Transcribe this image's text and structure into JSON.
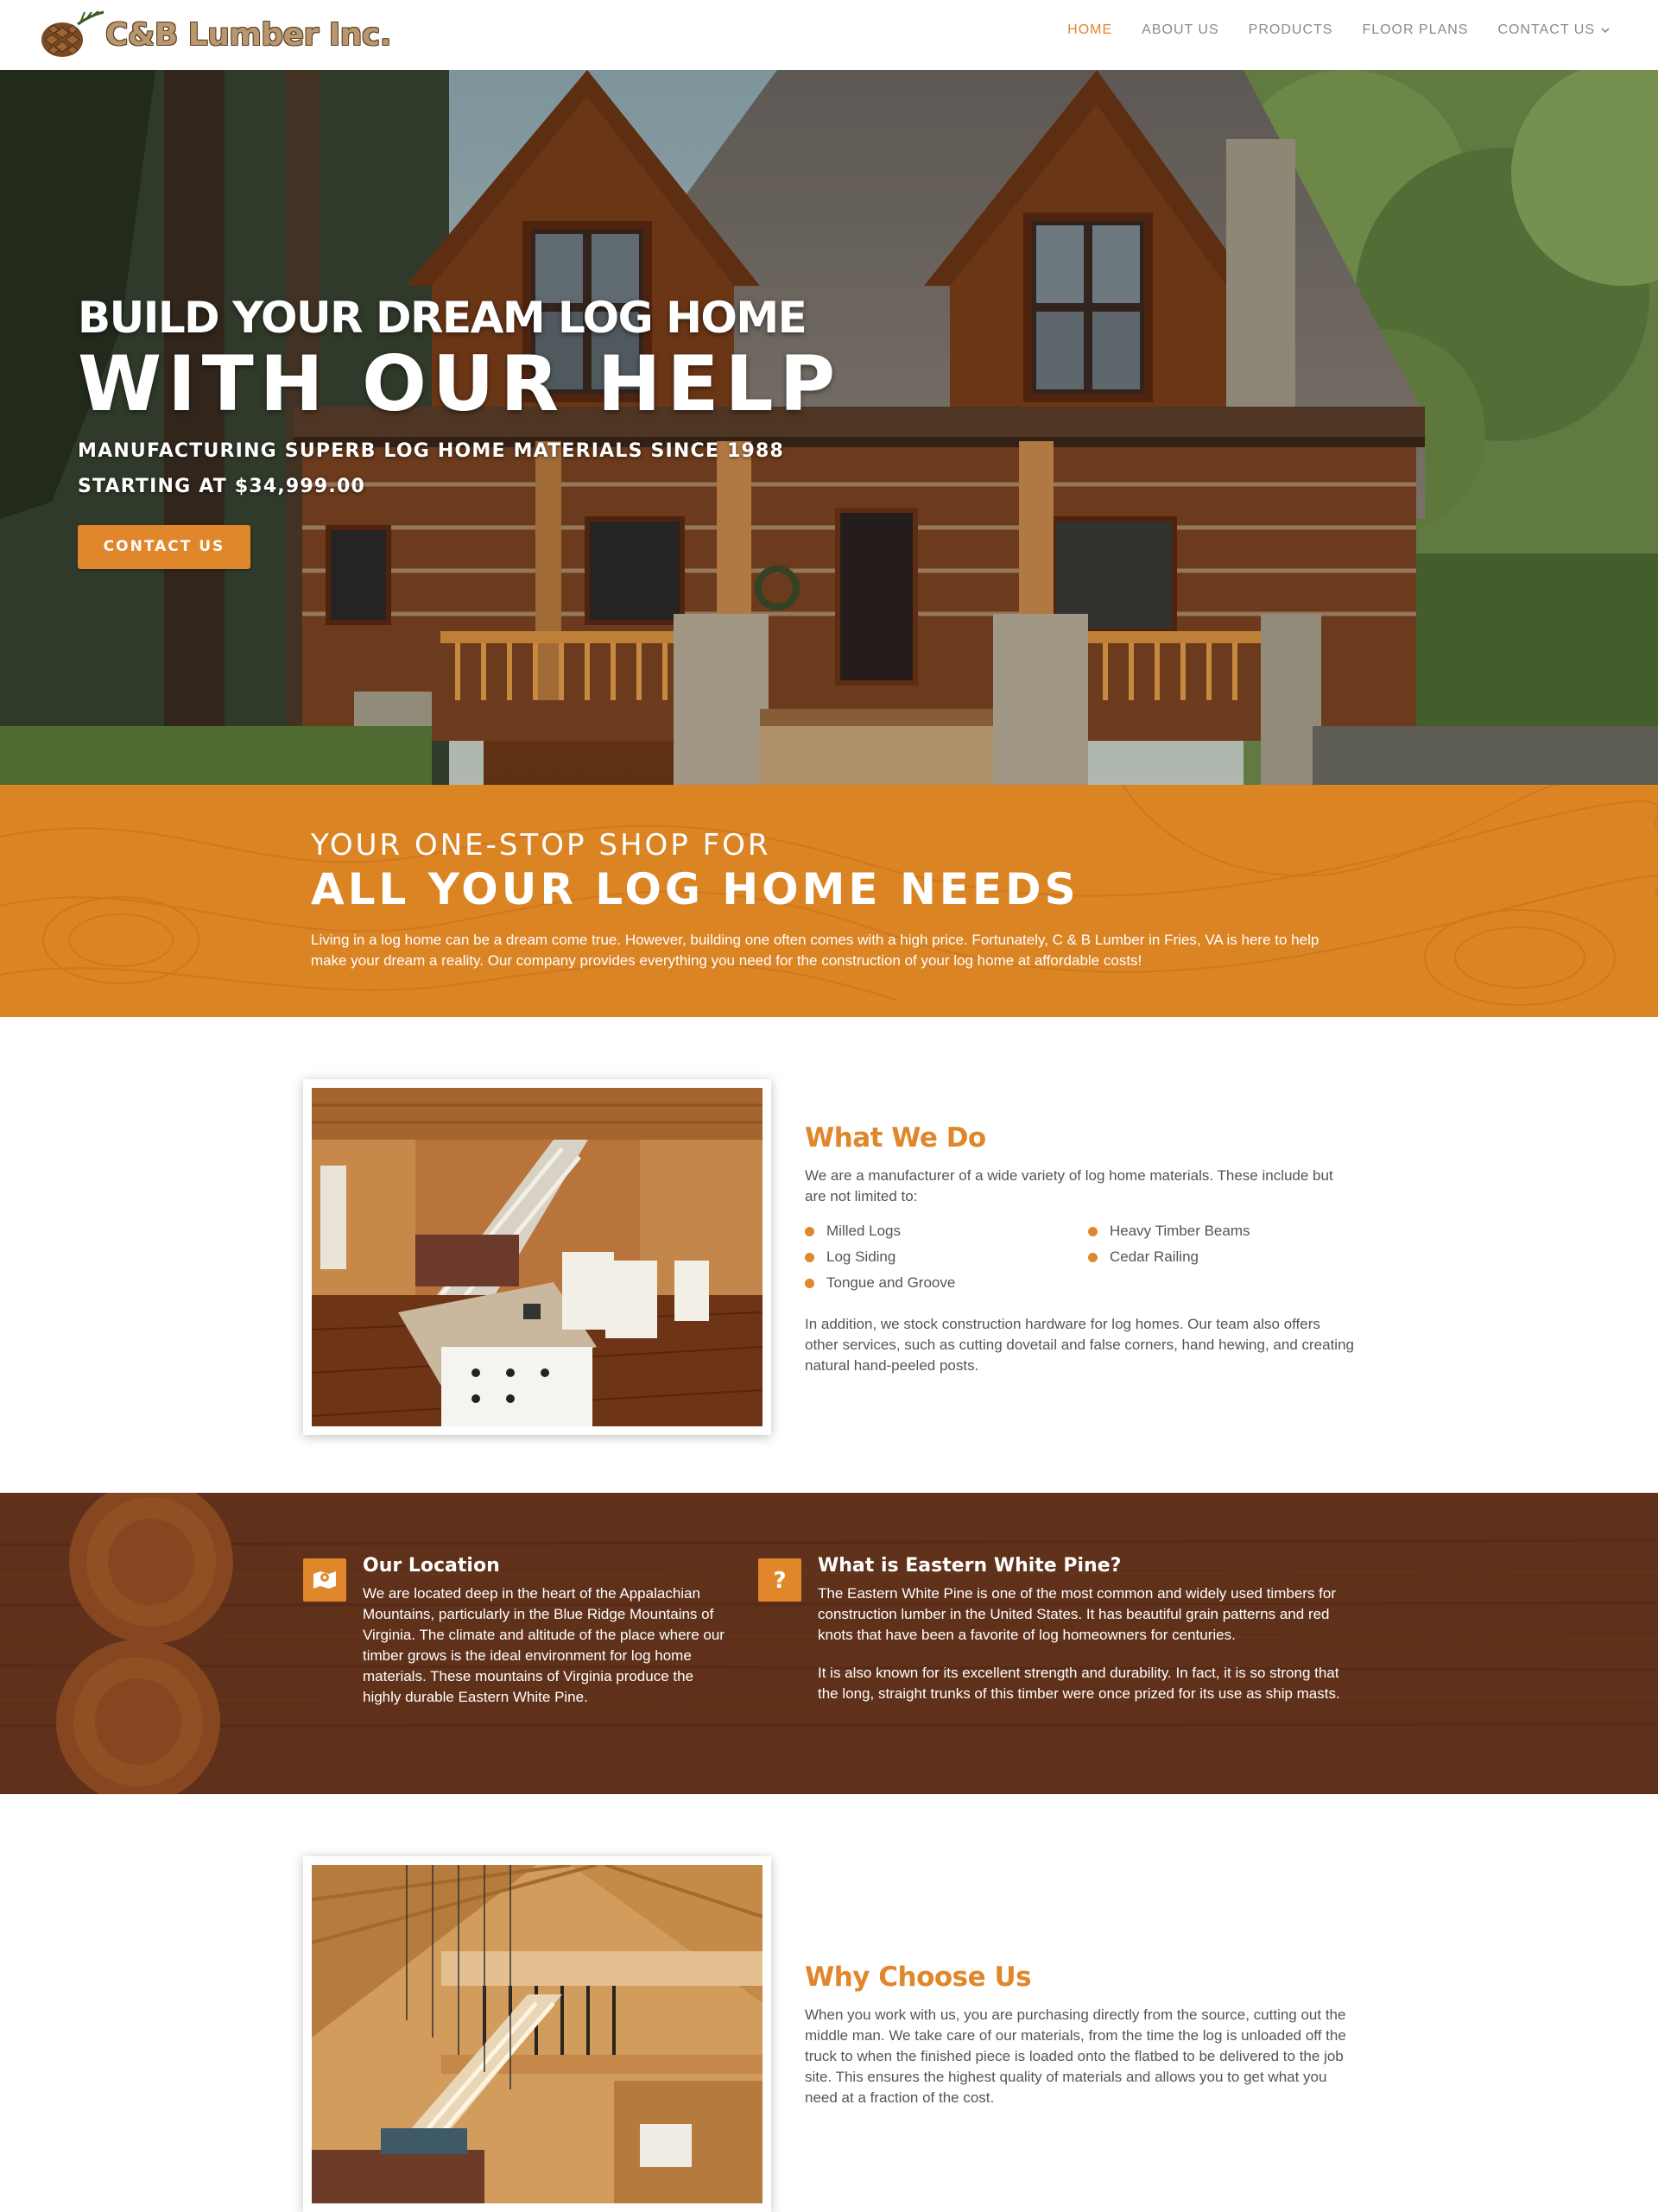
{
  "header": {
    "logo_text": "C&B Lumber Inc.",
    "nav": [
      {
        "label": "HOME",
        "active": true
      },
      {
        "label": "ABOUT US",
        "active": false
      },
      {
        "label": "PRODUCTS",
        "active": false
      },
      {
        "label": "FLOOR PLANS",
        "active": false
      },
      {
        "label": "CONTACT US",
        "active": false
      }
    ]
  },
  "hero": {
    "line1": "BUILD YOUR DREAM LOG HOME",
    "line2": "WITH OUR HELP",
    "subtitle": "MANUFACTURING SUPERB LOG HOME MATERIALS SINCE 1988",
    "price": "STARTING AT $34,999.00",
    "button": "CONTACT US"
  },
  "intro": {
    "line1": "YOUR ONE-STOP SHOP FOR",
    "line2": "ALL YOUR LOG HOME NEEDS",
    "text": "Living in a log home can be a dream come true. However, building one often comes with a high price. Fortunately, C & B Lumber in Fries, VA is here to help make your dream a reality. Our company provides everything you need for the construction of your log home at affordable costs!"
  },
  "what_we_do": {
    "title": "What We Do",
    "intro": "We are a manufacturer of a wide variety of log home materials. These include but are not limited to:",
    "items": [
      "Milled Logs",
      "Heavy Timber Beams",
      "Log Siding",
      "Cedar Railing",
      "Tongue and Groove"
    ],
    "extra": "In addition, we stock construction hardware for log homes. Our team also offers other services, such as cutting dovetail and false corners, hand hewing, and creating natural hand-peeled posts."
  },
  "info": {
    "location": {
      "title": "Our Location",
      "text": "We are located deep in the heart of the Appalachian Mountains, particularly in the Blue Ridge Mountains of Virginia. The climate and altitude of the place where our timber grows is the ideal environment for log home materials. These mountains of Virginia produce the highly durable Eastern White Pine."
    },
    "pine": {
      "title": "What is Eastern White Pine?",
      "text1": "The Eastern White Pine is one of the most common and widely used timbers for construction lumber in the United States. It has beautiful grain patterns and red knots that have been a favorite of log homeowners for centuries.",
      "text2": "It is also known for its excellent strength and durability. In fact, it is so strong that the long, straight trunks of this timber were once prized for its use as ship masts."
    }
  },
  "why": {
    "title": "Why Choose Us",
    "text": "When you work with us, you are purchasing directly from the source, cutting out the middle man. We take care of our materials, from the time the log is unloaded off the truck to when the finished piece is loaded onto the flatbed to be delivered to the job site. This ensures the highest quality of materials and allows you to get what you need at a fraction of the cost."
  },
  "colors": {
    "accent": "#e0862b",
    "band": "#db8424",
    "wood": "#6b3820"
  }
}
